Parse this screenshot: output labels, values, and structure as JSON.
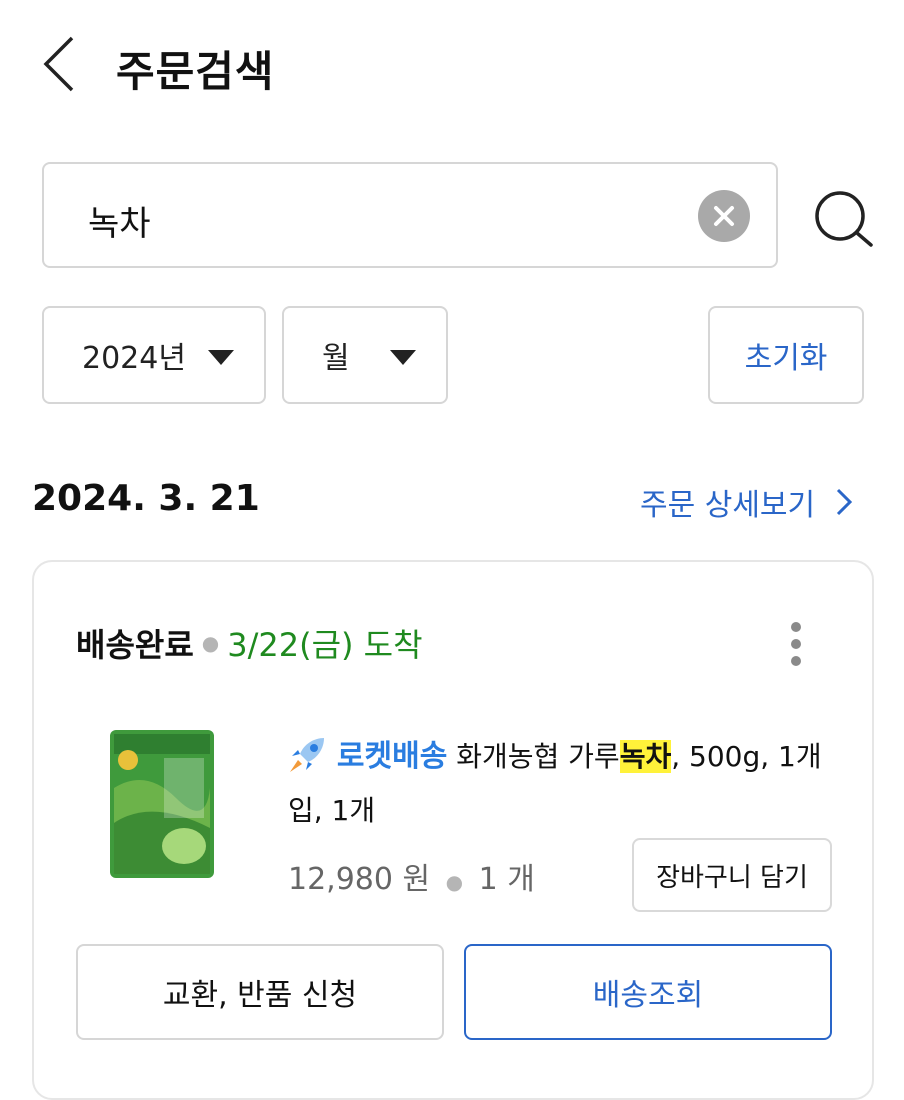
{
  "header": {
    "title": "주문검색",
    "back_icon": "chevron-left-icon"
  },
  "search": {
    "value": "녹차",
    "clear_icon": "clear-circle-icon",
    "search_icon": "search-icon"
  },
  "filters": {
    "year": "2024년",
    "month": "월",
    "reset_label": "초기화"
  },
  "order": {
    "date": "2024. 3. 21",
    "detail_link": "주문 상세보기",
    "status": "배송완료",
    "arrival": "3/22(금) 도착",
    "product": {
      "badge": "로켓배송",
      "name_prefix": "화개농협 가루",
      "name_highlight": "녹차",
      "name_suffix": ", 500g, 1개입, 1개",
      "price": "12,980 원",
      "quantity": "1 개",
      "cart_button": "장바구니 담기"
    },
    "return_button": "교환, 반품 신청",
    "track_button": "배송조회"
  },
  "colors": {
    "accent": "#2a66c8",
    "arrival": "#1f8a1f",
    "highlight": "#fff23a",
    "rocket": "#2a7de0"
  }
}
